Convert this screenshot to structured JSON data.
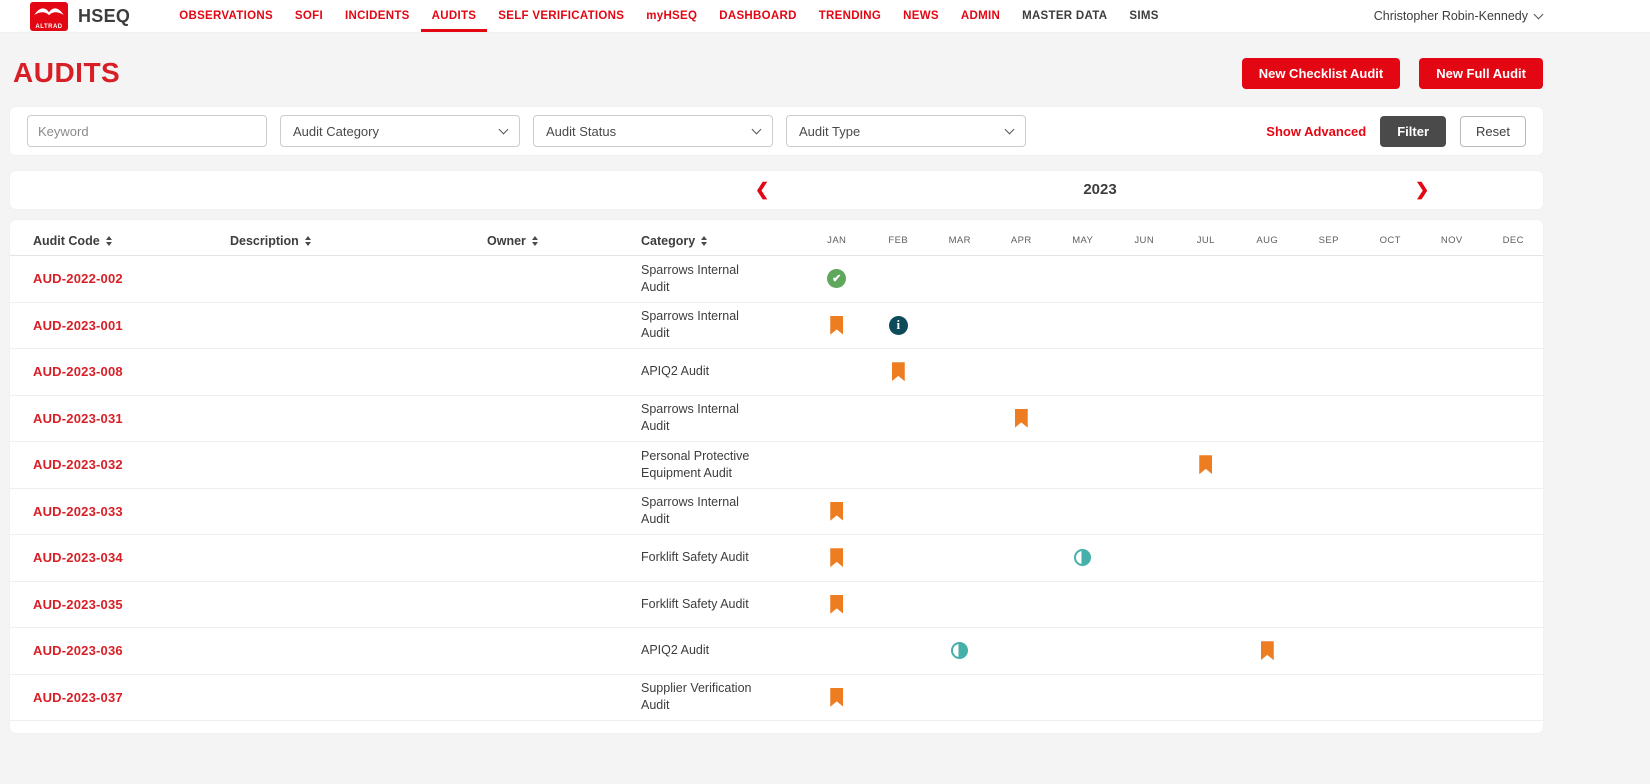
{
  "brand": {
    "logo_text": "ALTRAD",
    "app_name": "HSEQ"
  },
  "nav": {
    "items": [
      {
        "label": "OBSERVATIONS",
        "style": "red",
        "active": false
      },
      {
        "label": "SOFI",
        "style": "red",
        "active": false
      },
      {
        "label": "INCIDENTS",
        "style": "red",
        "active": false
      },
      {
        "label": "AUDITS",
        "style": "red",
        "active": true
      },
      {
        "label": "SELF VERIFICATIONS",
        "style": "red",
        "active": false
      },
      {
        "label": "myHSEQ",
        "style": "red",
        "active": false
      },
      {
        "label": "DASHBOARD",
        "style": "red",
        "active": false
      },
      {
        "label": "TRENDING",
        "style": "red",
        "active": false
      },
      {
        "label": "NEWS",
        "style": "red",
        "active": false
      },
      {
        "label": "ADMIN",
        "style": "red",
        "active": false
      },
      {
        "label": "MASTER DATA",
        "style": "dark",
        "active": false
      },
      {
        "label": "SIMS",
        "style": "dark",
        "active": false
      }
    ],
    "user": "Christopher Robin-Kennedy"
  },
  "page": {
    "title": "AUDITS",
    "new_checklist_audit": "New Checklist Audit",
    "new_full_audit": "New Full Audit"
  },
  "filters": {
    "keyword_placeholder": "Keyword",
    "audit_category": "Audit Category",
    "audit_status": "Audit Status",
    "audit_type": "Audit Type",
    "show_advanced": "Show Advanced",
    "filter_label": "Filter",
    "reset_label": "Reset"
  },
  "year_nav": {
    "year": "2023"
  },
  "table": {
    "columns": [
      "Audit Code",
      "Description",
      "Owner",
      "Category"
    ],
    "months": [
      "JAN",
      "FEB",
      "MAR",
      "APR",
      "MAY",
      "JUN",
      "JUL",
      "AUG",
      "SEP",
      "OCT",
      "NOV",
      "DEC"
    ],
    "rows": [
      {
        "code": "AUD-2022-002",
        "description": "",
        "owner": "",
        "category": "Sparrows Internal Audit",
        "icons": [
          {
            "month": "JAN",
            "type": "check-circle"
          }
        ]
      },
      {
        "code": "AUD-2023-001",
        "description": "",
        "owner": "",
        "category": "Sparrows Internal Audit",
        "icons": [
          {
            "month": "JAN",
            "type": "bookmark"
          },
          {
            "month": "FEB",
            "type": "info-circle"
          }
        ]
      },
      {
        "code": "AUD-2023-008",
        "description": "",
        "owner": "",
        "category": "APIQ2 Audit",
        "icons": [
          {
            "month": "FEB",
            "type": "bookmark"
          }
        ]
      },
      {
        "code": "AUD-2023-031",
        "description": "",
        "owner": "",
        "category": "Sparrows Internal Audit",
        "icons": [
          {
            "month": "APR",
            "type": "bookmark"
          }
        ]
      },
      {
        "code": "AUD-2023-032",
        "description": "",
        "owner": "",
        "category": "Personal Protective Equipment Audit",
        "icons": [
          {
            "month": "JUL",
            "type": "bookmark"
          }
        ]
      },
      {
        "code": "AUD-2023-033",
        "description": "",
        "owner": "",
        "category": "Sparrows Internal Audit",
        "icons": [
          {
            "month": "JAN",
            "type": "bookmark"
          }
        ]
      },
      {
        "code": "AUD-2023-034",
        "description": "",
        "owner": "",
        "category": "Forklift Safety Audit",
        "icons": [
          {
            "month": "JAN",
            "type": "bookmark"
          },
          {
            "month": "MAY",
            "type": "half-circle"
          }
        ]
      },
      {
        "code": "AUD-2023-035",
        "description": "",
        "owner": "",
        "category": "Forklift Safety Audit",
        "icons": [
          {
            "month": "JAN",
            "type": "bookmark"
          }
        ]
      },
      {
        "code": "AUD-2023-036",
        "description": "",
        "owner": "",
        "category": "APIQ2 Audit",
        "icons": [
          {
            "month": "MAR",
            "type": "half-circle"
          },
          {
            "month": "AUG",
            "type": "bookmark"
          }
        ]
      },
      {
        "code": "AUD-2023-037",
        "description": "",
        "owner": "",
        "category": "Supplier Verification Audit",
        "icons": [
          {
            "month": "JAN",
            "type": "bookmark"
          }
        ]
      }
    ]
  },
  "colors": {
    "brand_red": "#e30613",
    "title_red": "#d81f26",
    "bookmark_orange": "#ee7d22",
    "check_green": "#5ea75d",
    "info_dark_teal": "#0e4b5a",
    "half_teal": "#45b0aa",
    "filter_button_gray": "#4a4a4b",
    "dark_text": "#3d3d3c",
    "page_bg": "#f4f4f5"
  }
}
